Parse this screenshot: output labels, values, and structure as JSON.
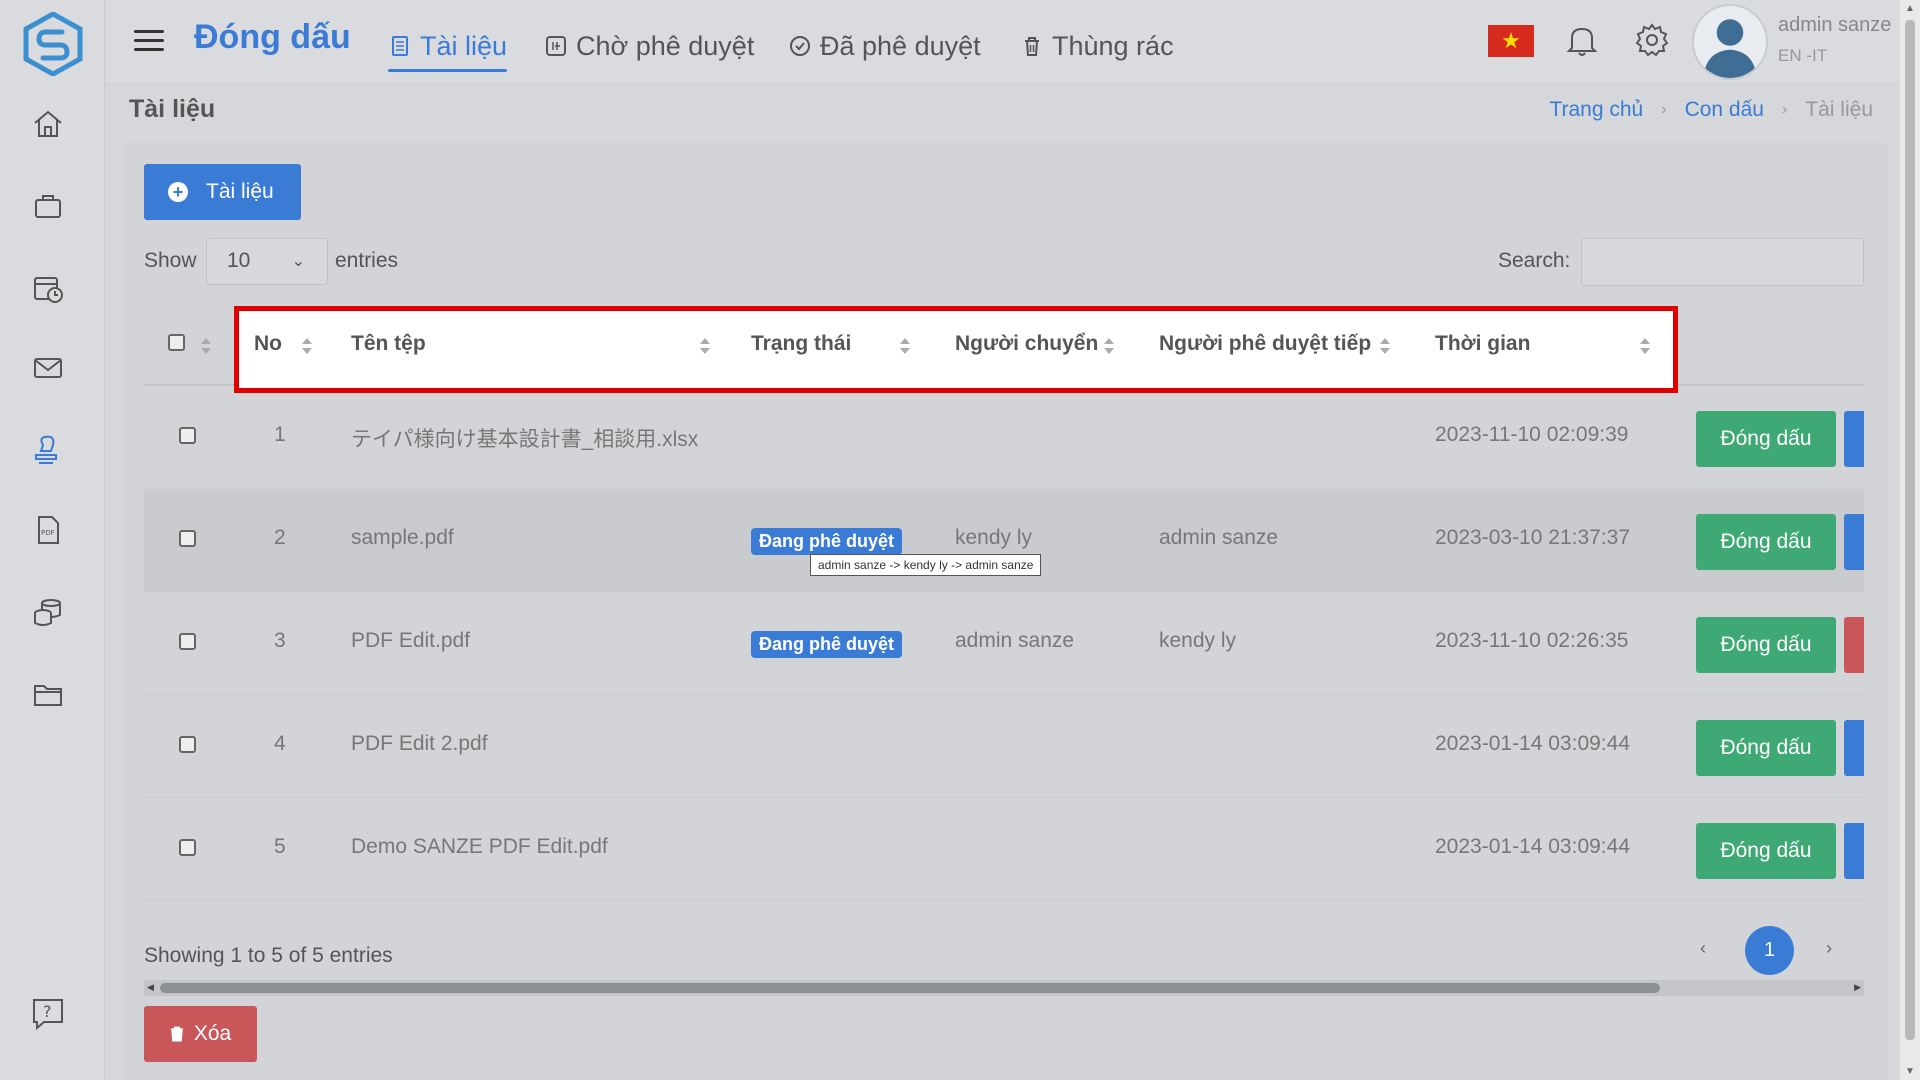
{
  "header": {
    "brand": "Đóng dấu",
    "tabs": [
      {
        "label": "Tài liệu",
        "icon": "document-icon",
        "active": true
      },
      {
        "label": "Chờ phê duyệt",
        "icon": "pending-icon",
        "active": false
      },
      {
        "label": "Đã phê duyệt",
        "icon": "approved-check-icon",
        "active": false
      },
      {
        "label": "Thùng rác",
        "icon": "trash-icon",
        "active": false
      }
    ],
    "user_name": "admin sanze",
    "user_sub": "EN -IT",
    "flag_symbol": "★"
  },
  "page": {
    "title": "Tài liệu",
    "breadcrumb": [
      {
        "label": "Trang chủ",
        "link": true
      },
      {
        "label": "Con dấu",
        "link": true
      },
      {
        "label": "Tài liệu",
        "link": false
      }
    ],
    "add_button": "Tài liệu",
    "show_label": "Show",
    "entries_value": "10",
    "entries_label": "entries",
    "search_label": "Search:",
    "search_value": ""
  },
  "table": {
    "columns": [
      "No",
      "Tên tệp",
      "Trạng thái",
      "Người chuyển",
      "Người phê duyệt tiếp",
      "Thời gian"
    ],
    "rows": [
      {
        "no": "1",
        "file": "テイパ様向け基本設計書_相談用.xlsx",
        "status": "",
        "sender": "",
        "next_approver": "",
        "time": "2023-11-10 02:09:39",
        "action": "Đóng dấu",
        "edge_color": "#3a7bd5"
      },
      {
        "no": "2",
        "file": "sample.pdf",
        "status": "Đang phê duyệt",
        "sender": "kendy ly",
        "next_approver": "admin sanze",
        "time": "2023-03-10 21:37:37",
        "action": "Đóng dấu",
        "edge_color": "#3a7bd5",
        "tooltip": "admin sanze -> kendy ly -> admin sanze"
      },
      {
        "no": "3",
        "file": "PDF Edit.pdf",
        "status": "Đang phê duyệt",
        "sender": "admin sanze",
        "next_approver": "kendy ly",
        "time": "2023-11-10 02:26:35",
        "action": "Đóng dấu",
        "edge_color": "#c9575a"
      },
      {
        "no": "4",
        "file": "PDF Edit 2.pdf",
        "status": "",
        "sender": "",
        "next_approver": "",
        "time": "2023-01-14 03:09:44",
        "action": "Đóng dấu",
        "edge_color": "#3a7bd5"
      },
      {
        "no": "5",
        "file": "Demo SANZE PDF Edit.pdf",
        "status": "",
        "sender": "",
        "next_approver": "",
        "time": "2023-01-14 03:09:44",
        "action": "Đóng dấu",
        "edge_color": "#3a7bd5"
      }
    ]
  },
  "footer": {
    "info": "Showing 1 to 5 of 5 entries",
    "current_page": "1",
    "prev": "‹",
    "next": "›",
    "delete_button": "Xóa"
  },
  "colors": {
    "accent": "#3a7bd5",
    "success": "#3fa976",
    "danger": "#c9575a",
    "highlight_border": "#e00000"
  }
}
